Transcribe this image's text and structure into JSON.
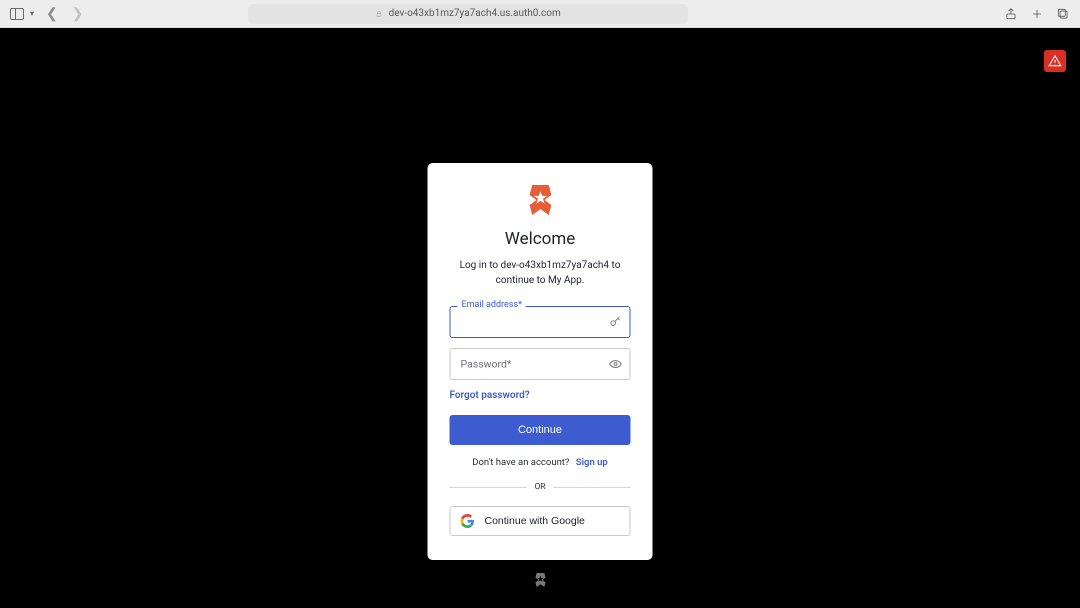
{
  "browser": {
    "url": "dev-o43xb1mz7ya7ach4.us.auth0.com"
  },
  "login": {
    "title": "Welcome",
    "subtitle": "Log in to dev-o43xb1mz7ya7ach4 to continue to My App.",
    "email_field": {
      "label": "Email address*",
      "value": ""
    },
    "password_field": {
      "label": "Password*",
      "value": ""
    },
    "forgot_password": "Forgot password?",
    "continue_button": "Continue",
    "signup_prompt": "Don't have an account?",
    "signup_link": "Sign up",
    "separator": "OR",
    "google_button": "Continue with Google"
  }
}
